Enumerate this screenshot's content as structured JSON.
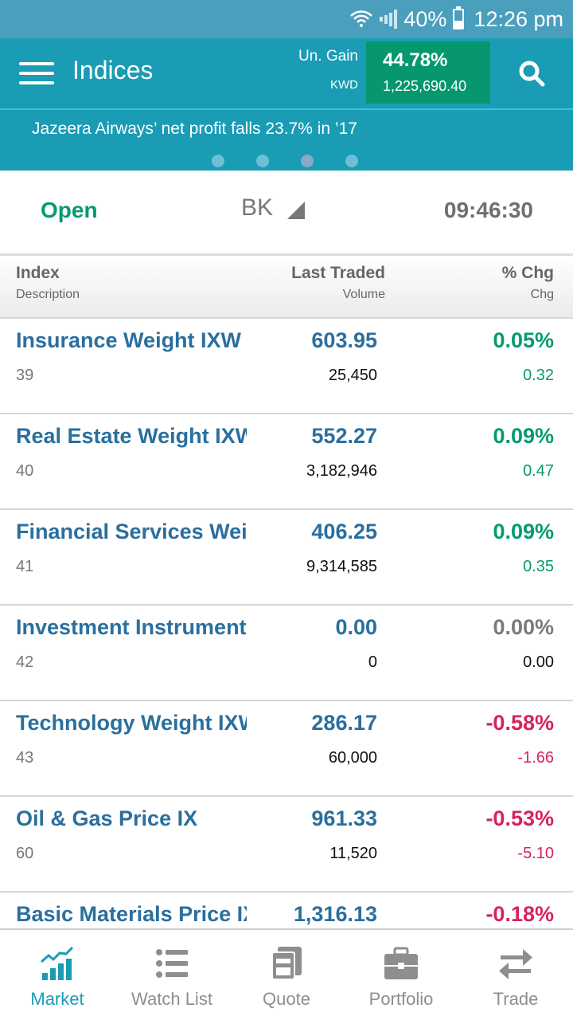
{
  "status_bar": {
    "battery": "40%",
    "time": "12:26 pm",
    "battery_level": 0.4
  },
  "app_bar": {
    "title": "Indices",
    "gain_label": "Un. Gain",
    "currency": "KWD",
    "gain_percent": "44.78%",
    "gain_value": "1,225,690.40"
  },
  "news": {
    "headline": "Jazeera Airways’ net profit falls 23.7% in ’17",
    "page_count": 4,
    "active_page": 3
  },
  "market": {
    "status": "Open",
    "exchange": "BK",
    "time": "09:46:30"
  },
  "table_header": {
    "col1_main": "Index",
    "col1_sub": "Description",
    "col2_main": "Last Traded",
    "col2_sub": "Volume",
    "col3_main": "% Chg",
    "col3_sub": "Chg"
  },
  "rows": [
    {
      "name": "Insurance Weight IXW",
      "code": "39",
      "last": "603.95",
      "volume": "25,450",
      "pct": "0.05%",
      "chg": "0.32",
      "trend": "up"
    },
    {
      "name": "Real Estate Weight IXW",
      "code": "40",
      "last": "552.27",
      "volume": "3,182,946",
      "pct": "0.09%",
      "chg": "0.47",
      "trend": "up"
    },
    {
      "name": "Financial Services Weight IXW",
      "code": "41",
      "last": "406.25",
      "volume": "9,314,585",
      "pct": "0.09%",
      "chg": "0.35",
      "trend": "up"
    },
    {
      "name": "Investment Instruments",
      "code": "42",
      "last": "0.00",
      "volume": "0",
      "pct": "0.00%",
      "chg": "0.00",
      "trend": "flat"
    },
    {
      "name": "Technology Weight IXW",
      "code": "43",
      "last": "286.17",
      "volume": "60,000",
      "pct": "-0.58%",
      "chg": "-1.66",
      "trend": "down"
    },
    {
      "name": "Oil & Gas Price IX",
      "code": "60",
      "last": "961.33",
      "volume": "11,520",
      "pct": "-0.53%",
      "chg": "-5.10",
      "trend": "down"
    },
    {
      "name": "Basic Materials Price IX",
      "code": "",
      "last": "1,316.13",
      "volume": "",
      "pct": "-0.18%",
      "chg": "",
      "trend": "down"
    }
  ],
  "bottom_nav": {
    "items": [
      {
        "label": "Market",
        "icon": "market-chart-icon",
        "active": true
      },
      {
        "label": "Watch List",
        "icon": "watch-list-icon",
        "active": false
      },
      {
        "label": "Quote",
        "icon": "quote-icon",
        "active": false
      },
      {
        "label": "Portfolio",
        "icon": "portfolio-briefcase-icon",
        "active": false
      },
      {
        "label": "Trade",
        "icon": "trade-arrows-icon",
        "active": false
      }
    ]
  },
  "colors": {
    "primary": "#1a9cb5",
    "status_bar": "#4a9fbd",
    "gain_box": "#06976f",
    "up": "#079a70",
    "down": "#d6245a",
    "index_name": "#2a6f9e"
  }
}
